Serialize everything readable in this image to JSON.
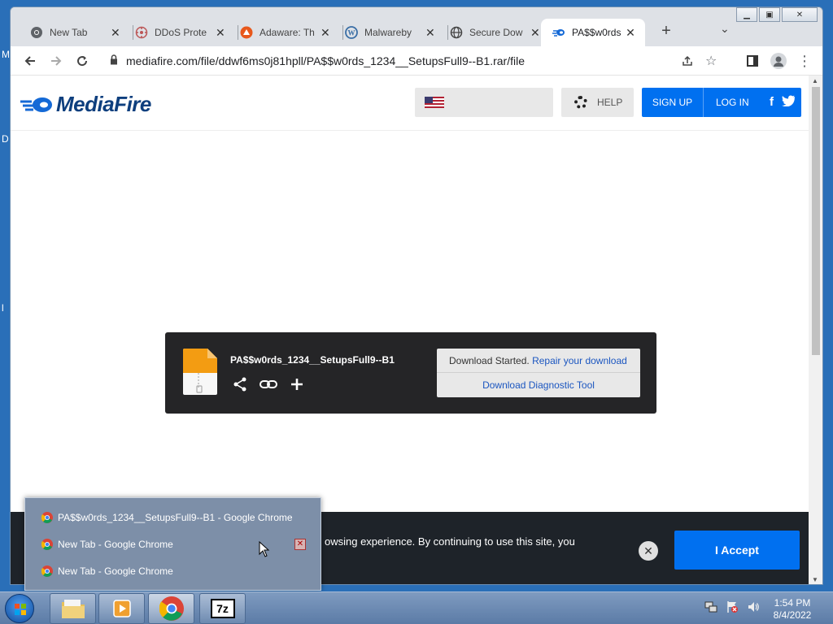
{
  "desktop": {
    "edge_letters": [
      "M",
      "D",
      "l"
    ]
  },
  "window": {
    "tabs": [
      {
        "label": "New Tab",
        "icon": "chrome-icon"
      },
      {
        "label": "DDoS Prote",
        "icon": "cloudflare-icon"
      },
      {
        "label": "Adaware: Th",
        "icon": "adaware-icon"
      },
      {
        "label": "Malwareby",
        "icon": "wordpress-icon"
      },
      {
        "label": "Secure Dow",
        "icon": "globe-icon"
      },
      {
        "label": "PA$$w0rds_",
        "icon": "mediafire-icon",
        "active": true
      }
    ]
  },
  "toolbar": {
    "url": "mediafire.com/file/ddwf6ms0j81hpll/PA$$w0rds_1234__SetupsFull9--B1.rar/file"
  },
  "site": {
    "logo_text": "MediaFire",
    "help_label": "HELP",
    "signup_label": "SIGN UP",
    "login_label": "LOG IN",
    "facebook_glyph": "f",
    "brand_color": "#0070f0"
  },
  "download": {
    "file_name": "PA$$w0rds_1234__SetupsFull9--B1",
    "status_prefix": "Download Started.",
    "repair_link": "Repair your download",
    "diagnostic_link": "Download Diagnostic Tool"
  },
  "cookie": {
    "text_visible": "owsing experience. By continuing to use this site, you",
    "accept_label": "I Accept",
    "close_glyph": "✕"
  },
  "jumplist": {
    "items": [
      "PA$$w0rds_1234__SetupsFull9--B1 - Google Chrome",
      "New Tab - Google Chrome",
      "New Tab - Google Chrome"
    ]
  },
  "taskbar": {
    "apps": [
      "explorer",
      "media-player",
      "chrome",
      "7zip"
    ],
    "sevenzip_label": "7z",
    "time": "1:54 PM",
    "date": "8/4/2022"
  }
}
